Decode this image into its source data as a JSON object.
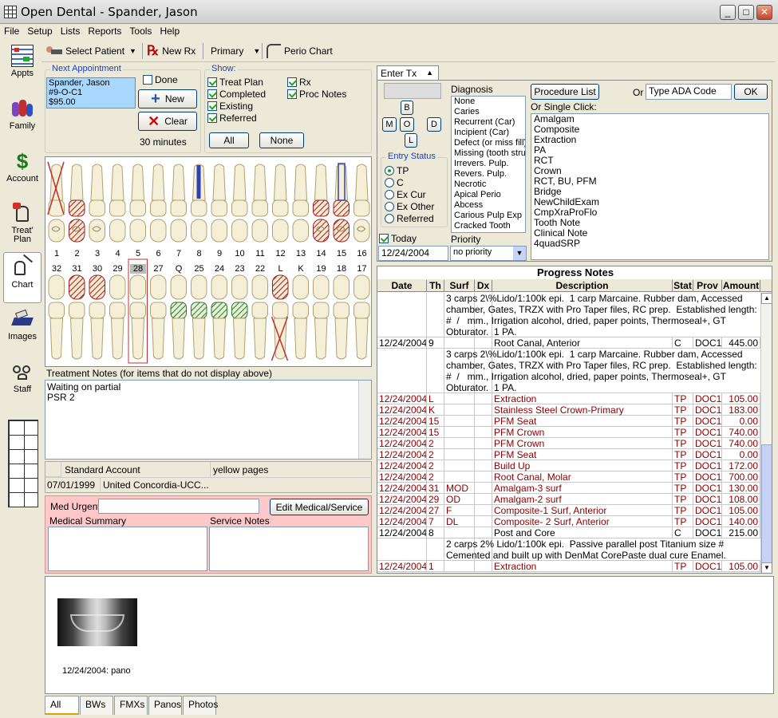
{
  "window": {
    "title": "Open Dental - Spander, Jason"
  },
  "menu": [
    "File",
    "Setup",
    "Lists",
    "Reports",
    "Tools",
    "Help"
  ],
  "toolbar": {
    "select_patient": "Select Patient",
    "new_rx": "New Rx",
    "primary": "Primary",
    "perio_chart": "Perio Chart"
  },
  "sidebar": [
    {
      "label": "Appts",
      "icon": "calendar-icon"
    },
    {
      "label": "Family",
      "icon": "family-icon"
    },
    {
      "label": "Account",
      "icon": "dollar-icon"
    },
    {
      "label": "Treat' Plan",
      "icon": "tooth-plan-icon"
    },
    {
      "label": "Chart",
      "icon": "chart-tooth-icon"
    },
    {
      "label": "Images",
      "icon": "scanner-icon"
    },
    {
      "label": "Staff",
      "icon": "staff-icon"
    }
  ],
  "next_appt": {
    "label": "Next Appointment",
    "lines": [
      "Spander, Jason",
      "#9-O-C1",
      "$95.00"
    ],
    "done": "Done",
    "new": "New",
    "clear": "Clear",
    "duration": "30 minutes"
  },
  "show": {
    "label": "Show:",
    "treat_plan": "Treat Plan",
    "completed": "Completed",
    "existing": "Existing",
    "referred": "Referred",
    "rx": "Rx",
    "proc_notes": "Proc Notes",
    "all": "All",
    "none": "None"
  },
  "chart": {
    "upper_numbers": [
      "1",
      "2",
      "3",
      "4",
      "5",
      "6",
      "7",
      "8",
      "9",
      "10",
      "11",
      "12",
      "13",
      "14",
      "15",
      "16"
    ],
    "lower_numbers": [
      "32",
      "31",
      "30",
      "29",
      "28",
      "27",
      "Q",
      "25",
      "24",
      "23",
      "22",
      "L",
      "K",
      "19",
      "18",
      "17"
    ],
    "selected_tooth": "28"
  },
  "treatment_notes": {
    "label": "Treatment Notes (for items that do not display above)",
    "text": "Waiting on partial\nPSR 2"
  },
  "account": {
    "standard": "Standard Account",
    "referral": "yellow pages",
    "date": "07/01/1999",
    "insurance": "United Concordia-UCC..."
  },
  "medical": {
    "med_urgent": "Med Urgent",
    "edit_btn": "Edit Medical/Service",
    "medical_summary": "Medical Summary",
    "service_notes": "Service Notes"
  },
  "enter_tx": {
    "tab": "Enter Tx",
    "diagnosis_label": "Diagnosis",
    "diagnosis": [
      "None",
      "Caries",
      "Recurrent (Car)",
      "Incipient (Car)",
      "Defect (or miss fill)",
      "Missing (tooth struc",
      "Irrevers. Pulp.",
      "Revers. Pulp.",
      "Necrotic",
      "Apical Perio",
      "Abcess",
      "Carious Pulp Exp",
      "Cracked Tooth"
    ],
    "surfaces": [
      "B",
      "M",
      "O",
      "D",
      "L"
    ],
    "entry_status_label": "Entry Status",
    "statuses": [
      "TP",
      "C",
      "Ex Cur",
      "Ex Other",
      "Referred"
    ],
    "today": "Today",
    "date": "12/24/2004",
    "priority_label": "Priority",
    "priority": "no priority",
    "procedure_list": "Procedure List",
    "or": "Or",
    "ada_placeholder": "Type ADA Code",
    "ok": "OK",
    "single_click_label": "Or Single Click:",
    "single_click": [
      "Amalgam",
      "Composite",
      "Extraction",
      "PA",
      "RCT",
      "Crown",
      "RCT, BU, PFM",
      "Bridge",
      "NewChildExam",
      "CmpXraProFlo",
      "Tooth Note",
      "Clinical Note",
      "4quadSRP"
    ]
  },
  "progress": {
    "title": "Progress Notes",
    "headers": [
      "Date",
      "Th",
      "Surf",
      "Dx",
      "Description",
      "Stat",
      "Prov",
      "Amount"
    ],
    "rows": [
      {
        "type": "note",
        "text": "3 carps 2\\%Lido/1:100k epi.  1 carp Marcaine. Rubber dam, Accessed chamber, Gates, TRZX with Pro Taper files, RC prep.  Established length: #  /   mm., Irrigation alcohol, dried, paper points, Thermoseal+, GT Obturator.  1 PA.",
        "lines": 4
      },
      {
        "type": "row",
        "color": "#000000",
        "date": "12/24/2004",
        "th": "9",
        "surf": "",
        "dx": "",
        "desc": "Root Canal, Anterior",
        "stat": "C",
        "prov": "DOC1",
        "amt": "445.00"
      },
      {
        "type": "note",
        "text": "3 carps 2\\%Lido/1:100k epi.  1 carp Marcaine. Rubber dam, Accessed chamber, Gates, TRZX with Pro Taper files, RC prep.  Established length: #  /   mm., Irrigation alcohol, dried, paper points, Thermoseal+, GT Obturator.  1 PA.",
        "lines": 4
      },
      {
        "type": "row",
        "color": "#8b0000",
        "date": "12/24/2004",
        "th": "L",
        "surf": "",
        "dx": "",
        "desc": "Extraction",
        "stat": "TP",
        "prov": "DOC1",
        "amt": "105.00"
      },
      {
        "type": "row",
        "color": "#8b0000",
        "date": "12/24/2004",
        "th": "K",
        "surf": "",
        "dx": "",
        "desc": "Stainless Steel Crown-Primary",
        "stat": "TP",
        "prov": "DOC1",
        "amt": "183.00"
      },
      {
        "type": "row",
        "color": "#8b0000",
        "date": "12/24/2004",
        "th": "15",
        "surf": "",
        "dx": "",
        "desc": "PFM Seat",
        "stat": "TP",
        "prov": "DOC1",
        "amt": "0.00"
      },
      {
        "type": "row",
        "color": "#8b0000",
        "date": "12/24/2004",
        "th": "15",
        "surf": "",
        "dx": "",
        "desc": "PFM Crown",
        "stat": "TP",
        "prov": "DOC1",
        "amt": "740.00"
      },
      {
        "type": "row",
        "color": "#8b0000",
        "date": "12/24/2004",
        "th": "2",
        "surf": "",
        "dx": "",
        "desc": "PFM Crown",
        "stat": "TP",
        "prov": "DOC1",
        "amt": "740.00"
      },
      {
        "type": "row",
        "color": "#8b0000",
        "date": "12/24/2004",
        "th": "2",
        "surf": "",
        "dx": "",
        "desc": "PFM Seat",
        "stat": "TP",
        "prov": "DOC1",
        "amt": "0.00"
      },
      {
        "type": "row",
        "color": "#8b0000",
        "date": "12/24/2004",
        "th": "2",
        "surf": "",
        "dx": "",
        "desc": "Build Up",
        "stat": "TP",
        "prov": "DOC1",
        "amt": "172.00"
      },
      {
        "type": "row",
        "color": "#8b0000",
        "date": "12/24/2004",
        "th": "2",
        "surf": "",
        "dx": "",
        "desc": "Root Canal, Molar",
        "stat": "TP",
        "prov": "DOC1",
        "amt": "700.00"
      },
      {
        "type": "row",
        "color": "#8b0000",
        "date": "12/24/2004",
        "th": "31",
        "surf": "MOD",
        "dx": "",
        "desc": "Amalgam-3 surf",
        "stat": "TP",
        "prov": "DOC1",
        "amt": "130.00"
      },
      {
        "type": "row",
        "color": "#8b0000",
        "date": "12/24/2004",
        "th": "29",
        "surf": "OD",
        "dx": "",
        "desc": "Amalgam-2 surf",
        "stat": "TP",
        "prov": "DOC1",
        "amt": "108.00"
      },
      {
        "type": "row",
        "color": "#8b0000",
        "date": "12/24/2004",
        "th": "27",
        "surf": "F",
        "dx": "",
        "desc": "Composite-1 Surf, Anterior",
        "stat": "TP",
        "prov": "DOC1",
        "amt": "105.00"
      },
      {
        "type": "row",
        "color": "#8b0000",
        "date": "12/24/2004",
        "th": "7",
        "surf": "DL",
        "dx": "",
        "desc": "Composite- 2 Surf, Anterior",
        "stat": "TP",
        "prov": "DOC1",
        "amt": "140.00"
      },
      {
        "type": "row",
        "color": "#000000",
        "date": "12/24/2004",
        "th": "8",
        "surf": "",
        "dx": "",
        "desc": "Post and Core",
        "stat": "C",
        "prov": "DOC1",
        "amt": "215.00"
      },
      {
        "type": "note",
        "text": "2 carps 2% Lido/1:100k epi.  Passive parallel post Titanium size # Cemented and built up with DenMat CorePaste dual cure Enamel.",
        "lines": 2
      },
      {
        "type": "row",
        "color": "#8b0000",
        "date": "12/24/2004",
        "th": "1",
        "surf": "",
        "dx": "",
        "desc": "Extraction",
        "stat": "TP",
        "prov": "DOC1",
        "amt": "105.00"
      }
    ]
  },
  "images": {
    "caption": "12/24/2004: pano",
    "tabs": [
      "All",
      "BWs",
      "FMXs",
      "Panos",
      "Photos"
    ]
  }
}
